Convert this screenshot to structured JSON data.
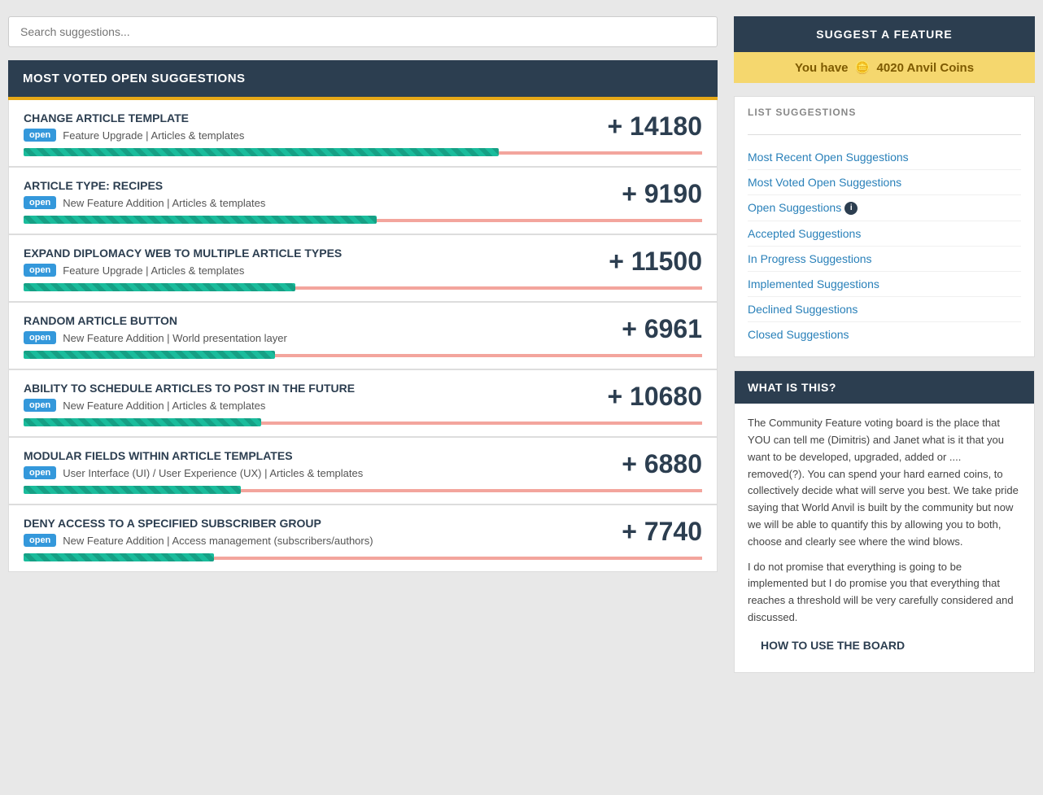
{
  "search": {
    "placeholder": "Search suggestions..."
  },
  "section": {
    "title": "MOST VOTED OPEN SUGGESTIONS"
  },
  "suggestions": [
    {
      "title": "CHANGE ARTICLE TEMPLATE",
      "badge": "open",
      "meta": "Feature Upgrade | Articles & templates",
      "votes": "+ 14180",
      "progress_pct": 70
    },
    {
      "title": "ARTICLE TYPE: RECIPES",
      "badge": "open",
      "meta": "New Feature Addition | Articles & templates",
      "votes": "+ 9190",
      "progress_pct": 52
    },
    {
      "title": "EXPAND DIPLOMACY WEB TO MULTIPLE ARTICLE TYPES",
      "badge": "open",
      "meta": "Feature Upgrade | Articles & templates",
      "votes": "+ 11500",
      "progress_pct": 40
    },
    {
      "title": "RANDOM ARTICLE BUTTON",
      "badge": "open",
      "meta": "New Feature Addition | World presentation layer",
      "votes": "+ 6961",
      "progress_pct": 37
    },
    {
      "title": "ABILITY TO SCHEDULE ARTICLES TO POST IN THE FUTURE",
      "badge": "open",
      "meta": "New Feature Addition | Articles & templates",
      "votes": "+ 10680",
      "progress_pct": 35
    },
    {
      "title": "MODULAR FIELDS WITHIN ARTICLE TEMPLATES",
      "badge": "open",
      "meta": "User Interface (UI) / User Experience (UX) | Articles & templates",
      "votes": "+ 6880",
      "progress_pct": 32
    },
    {
      "title": "DENY ACCESS TO A SPECIFIED SUBSCRIBER GROUP",
      "badge": "open",
      "meta": "New Feature Addition | Access management (subscribers/authors)",
      "votes": "+ 7740",
      "progress_pct": 28
    }
  ],
  "sidebar": {
    "suggest_btn": "SUGGEST A FEATURE",
    "coins_prefix": "You have",
    "coins_value": "4020 Anvil Coins",
    "list_label": "LIST SUGGESTIONS",
    "links": [
      {
        "label": "Most Recent Open Suggestions",
        "info": false
      },
      {
        "label": "Most Voted Open Suggestions",
        "info": false
      },
      {
        "label": "Open Suggestions",
        "info": true
      },
      {
        "label": "Accepted Suggestions",
        "info": false
      },
      {
        "label": "In Progress Suggestions",
        "info": false
      },
      {
        "label": "Implemented Suggestions",
        "info": false
      },
      {
        "label": "Declined Suggestions",
        "info": false
      },
      {
        "label": "Closed Suggestions",
        "info": false
      }
    ],
    "what_is_header": "WHAT IS THIS?",
    "what_is_text1": "The Community Feature voting board is the place that YOU can tell me (Dimitris) and Janet what is it that you want to be developed, upgraded, added or .... removed(?). You can spend your hard earned coins, to collectively decide what will serve you best. We take pride saying that World Anvil is built by the community but now we will be able to quantify this by allowing you to both, choose and clearly see where the wind blows.",
    "what_is_text2": "I do not promise that everything is going to be implemented but I do promise you that everything that reaches a threshold will be very carefully considered and discussed.",
    "how_to_header": "HOW TO USE THE BOARD"
  }
}
